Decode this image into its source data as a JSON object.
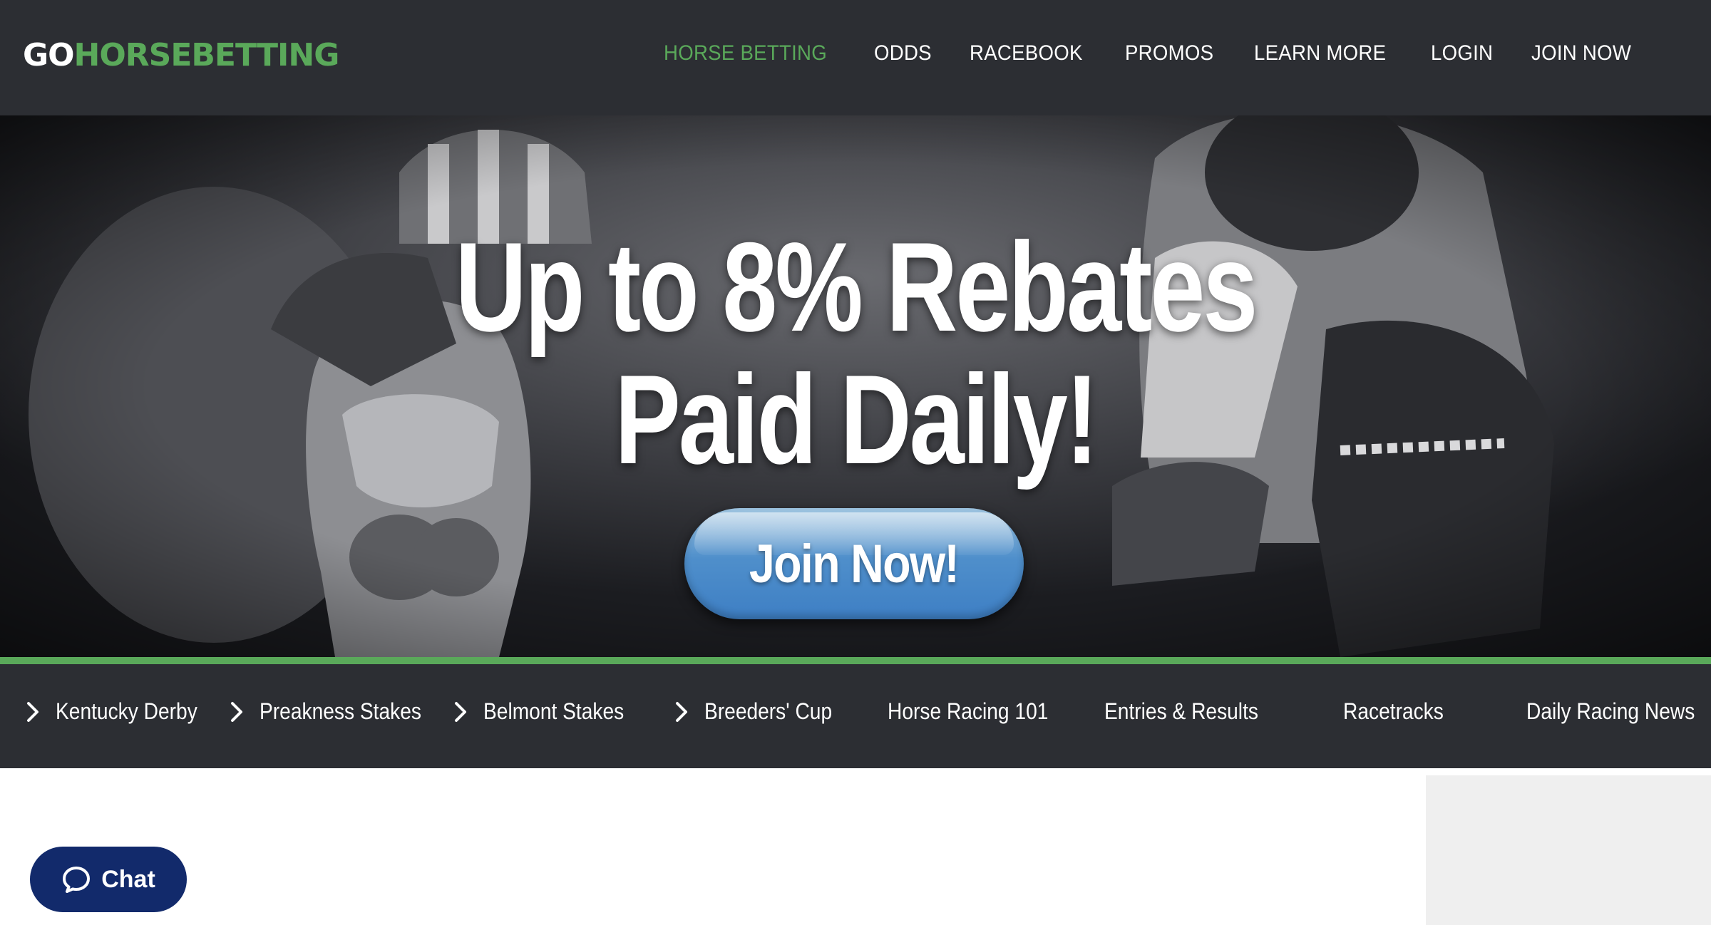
{
  "brand": {
    "part1": "GO",
    "part2": "HORSEBETTING",
    "color_white": "#ffffff",
    "color_green": "#5aa95a"
  },
  "nav": [
    {
      "label": "HORSE BETTING",
      "active": true
    },
    {
      "label": "ODDS"
    },
    {
      "label": "RACEBOOK"
    },
    {
      "label": "PROMOS"
    },
    {
      "label": "LEARN MORE"
    },
    {
      "label": "LOGIN"
    },
    {
      "label": "JOIN NOW"
    }
  ],
  "hero": {
    "line1": "Up to 8% Rebates",
    "line2": "Paid Daily!",
    "cta": "Join Now!"
  },
  "subnav": [
    {
      "label": "Kentucky Derby",
      "icon": "chevron-right-icon"
    },
    {
      "label": "Preakness Stakes",
      "icon": "chevron-right-icon"
    },
    {
      "label": "Belmont Stakes",
      "icon": "chevron-right-icon"
    },
    {
      "label": "Breeders' Cup",
      "icon": "chevron-right-icon"
    },
    {
      "label": "Horse Racing 101"
    },
    {
      "label": "Entries & Results"
    },
    {
      "label": "Racetracks"
    },
    {
      "label": "Daily Racing News"
    }
  ],
  "chat": {
    "label": "Chat",
    "icon": "chat-bubble-icon",
    "color": "#122a6b"
  },
  "colors": {
    "header_bg": "#2c2e33",
    "accent_green": "#5aa95a",
    "cta_blue": "#3e7fc4"
  }
}
